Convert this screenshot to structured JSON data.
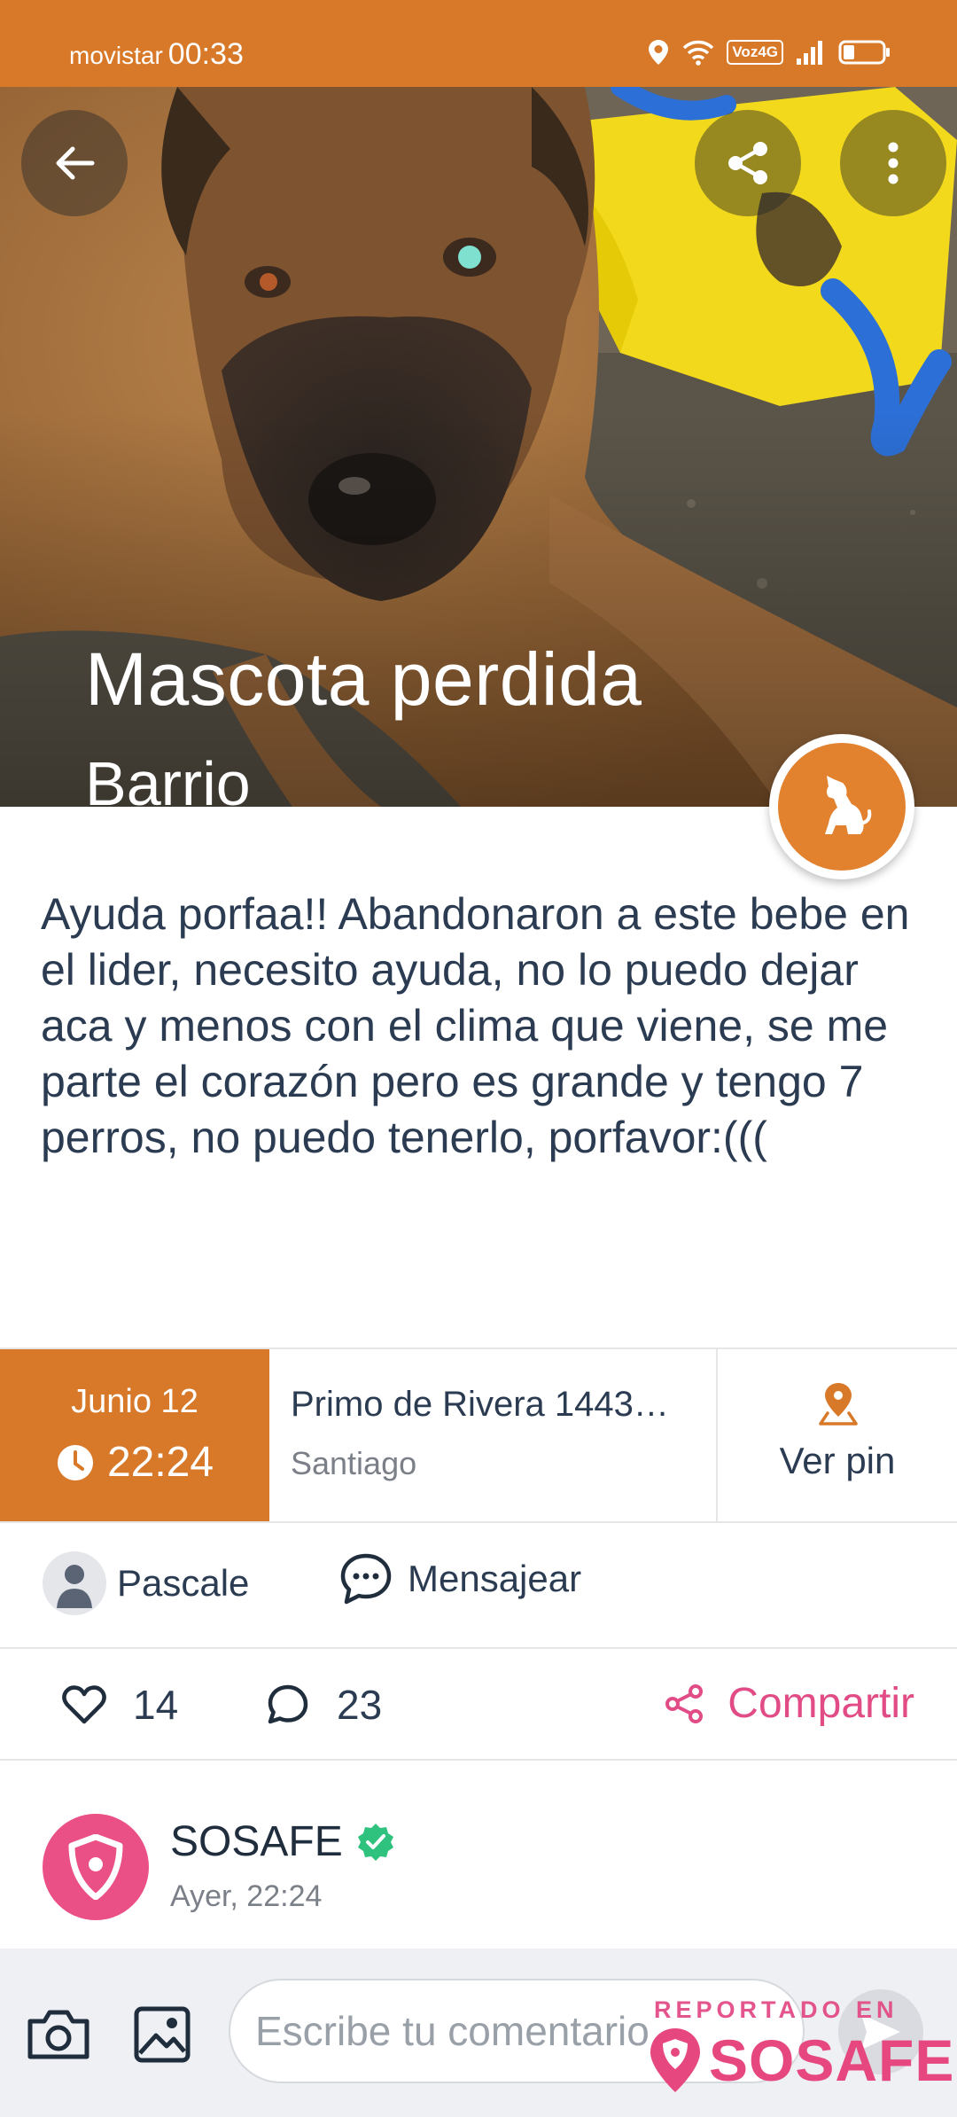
{
  "status_bar": {
    "carrier": "movistar",
    "time": "00:33",
    "network_badge": "Voz4G"
  },
  "post": {
    "title": "Mascota perdida",
    "subtitle": "Barrio",
    "carousel": {
      "count": 3,
      "active_index": 2
    },
    "category_icon": "dog-icon",
    "description": "Ayuda porfaa!! Abandonaron a este bebe en el lider, necesito ayuda, no lo puedo dejar aca y menos con el clima que viene, se me parte el corazón pero es grande y tengo 7 perros, no puedo tenerlo, porfavor:(((",
    "date": "Junio 12",
    "time": "22:24",
    "address": "Primo de Rivera  1443…",
    "city": "Santiago",
    "pin_label": "Ver pin",
    "author": "Pascale",
    "message_label": "Mensajear",
    "likes": "14",
    "comments": "23",
    "share_label": "Compartir"
  },
  "source": {
    "name": "SOSAFE",
    "time": "Ayer, 22:24"
  },
  "comment_bar": {
    "placeholder": "Escribe tu comentario..."
  },
  "watermark": {
    "top": "REPORTADO EN",
    "brand": "SOSAFE"
  },
  "colors": {
    "accent_orange": "#d8792a",
    "brand_pink": "#e24c86",
    "verified_green": "#2ec27e"
  }
}
